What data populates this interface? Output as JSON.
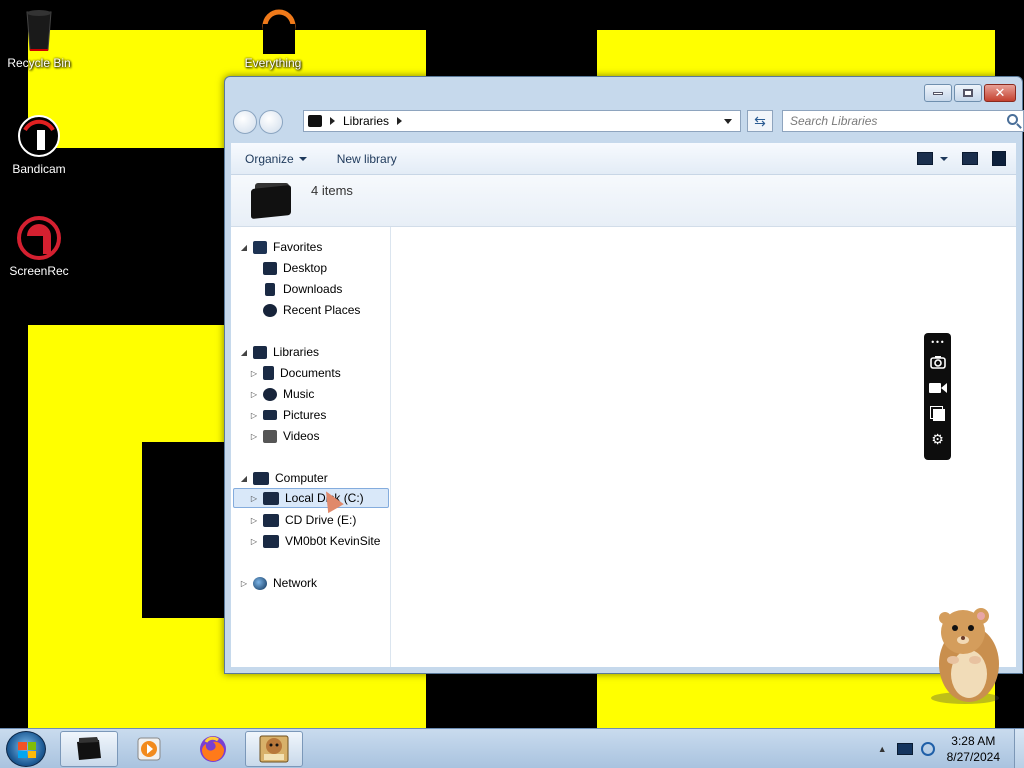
{
  "desktop": {
    "icons": [
      {
        "label": "Recycle Bin"
      },
      {
        "label": "Everything"
      },
      {
        "label": "Bandicam"
      },
      {
        "label": "ScreenRec"
      }
    ]
  },
  "window": {
    "address": {
      "crumb": "Libraries"
    },
    "search": {
      "placeholder": "Search Libraries"
    },
    "toolbar": {
      "organize": "Organize",
      "new_library": "New library"
    },
    "details": {
      "count": "4 items"
    },
    "nav": {
      "favorites": "Favorites",
      "desktop": "Desktop",
      "downloads": "Downloads",
      "recent_places": "Recent Places",
      "libraries": "Libraries",
      "documents": "Documents",
      "music": "Music",
      "pictures": "Pictures",
      "videos": "Videos",
      "computer": "Computer",
      "local_disk": "Local Disk (C:)",
      "cd_drive": "CD Drive (E:)",
      "network_share": "VM0b0t KevinSite",
      "network": "Network"
    }
  },
  "taskbar": {
    "time": "3:28 AM",
    "date": "8/27/2024"
  }
}
